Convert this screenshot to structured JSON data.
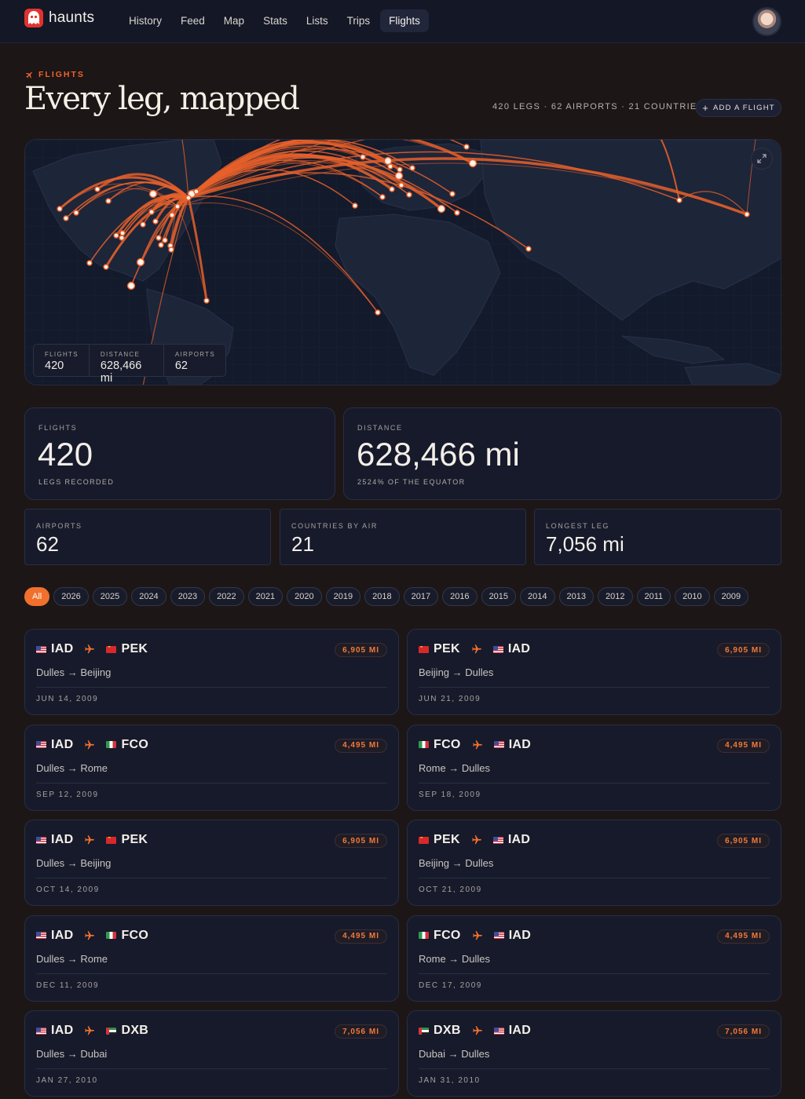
{
  "nav": {
    "brand": "haunts",
    "links": [
      "History",
      "Feed",
      "Map",
      "Stats",
      "Lists",
      "Trips",
      "Flights"
    ],
    "active": "Flights"
  },
  "header": {
    "eyebrow": "FLIGHTS",
    "title": "Every leg, mapped",
    "summary": "420 LEGS · 62 AIRPORTS · 21 COUNTRIES",
    "add_label": "ADD A FLIGHT"
  },
  "map": {
    "stats": [
      {
        "label": "FLIGHTS",
        "value": "420"
      },
      {
        "label": "DISTANCE",
        "value": "628,466 mi"
      },
      {
        "label": "AIRPORTS",
        "value": "62"
      }
    ]
  },
  "stats": {
    "flights": {
      "label": "FLIGHTS",
      "value": "420",
      "sub": "LEGS RECORDED"
    },
    "distance": {
      "label": "DISTANCE",
      "value": "628,466 mi",
      "sub": "2524% OF THE EQUATOR"
    },
    "airports": {
      "label": "AIRPORTS",
      "value": "62"
    },
    "countries": {
      "label": "COUNTRIES BY AIR",
      "value": "21"
    },
    "longest": {
      "label": "LONGEST LEG",
      "value": "7,056 mi"
    }
  },
  "years": [
    "All",
    "2026",
    "2025",
    "2024",
    "2023",
    "2022",
    "2021",
    "2020",
    "2019",
    "2018",
    "2017",
    "2016",
    "2015",
    "2014",
    "2013",
    "2012",
    "2011",
    "2010",
    "2009"
  ],
  "active_year": "All",
  "flights": [
    {
      "from": "IAD",
      "to": "PEK",
      "from_flag": "us",
      "to_flag": "cn",
      "names": "Dulles → Beijing",
      "date": "JUN 14, 2009",
      "distance": "6,905 MI"
    },
    {
      "from": "PEK",
      "to": "IAD",
      "from_flag": "cn",
      "to_flag": "us",
      "names": "Beijing → Dulles",
      "date": "JUN 21, 2009",
      "distance": "6,905 MI"
    },
    {
      "from": "IAD",
      "to": "FCO",
      "from_flag": "us",
      "to_flag": "it",
      "names": "Dulles → Rome",
      "date": "SEP 12, 2009",
      "distance": "4,495 MI"
    },
    {
      "from": "FCO",
      "to": "IAD",
      "from_flag": "it",
      "to_flag": "us",
      "names": "Rome → Dulles",
      "date": "SEP 18, 2009",
      "distance": "4,495 MI"
    },
    {
      "from": "IAD",
      "to": "PEK",
      "from_flag": "us",
      "to_flag": "cn",
      "names": "Dulles → Beijing",
      "date": "OCT 14, 2009",
      "distance": "6,905 MI"
    },
    {
      "from": "PEK",
      "to": "IAD",
      "from_flag": "cn",
      "to_flag": "us",
      "names": "Beijing → Dulles",
      "date": "OCT 21, 2009",
      "distance": "6,905 MI"
    },
    {
      "from": "IAD",
      "to": "FCO",
      "from_flag": "us",
      "to_flag": "it",
      "names": "Dulles → Rome",
      "date": "DEC 11, 2009",
      "distance": "4,495 MI"
    },
    {
      "from": "FCO",
      "to": "IAD",
      "from_flag": "it",
      "to_flag": "us",
      "names": "Rome → Dulles",
      "date": "DEC 17, 2009",
      "distance": "4,495 MI"
    },
    {
      "from": "IAD",
      "to": "DXB",
      "from_flag": "us",
      "to_flag": "ae",
      "names": "Dulles → Dubai",
      "date": "JAN 27, 2010",
      "distance": "7,056 MI"
    },
    {
      "from": "DXB",
      "to": "IAD",
      "from_flag": "ae",
      "to_flag": "us",
      "names": "Dubai → Dulles",
      "date": "JAN 31, 2010",
      "distance": "7,056 MI"
    }
  ],
  "colors": {
    "accent": "#f0702c",
    "route": "#e8602a",
    "bg": "#1c1617",
    "card": "#161a2b"
  }
}
